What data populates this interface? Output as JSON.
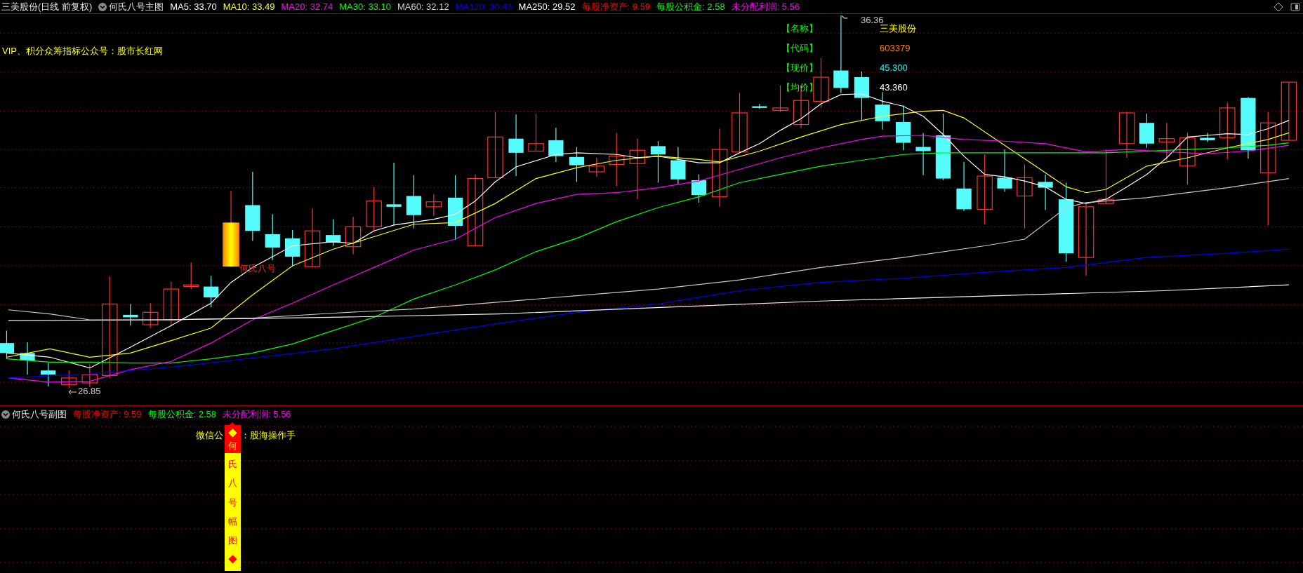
{
  "main_header": {
    "stock": "三美股份(日线 前复权)",
    "indicator": "何氏八号主图",
    "ma": [
      {
        "label": "MA5: 33.70",
        "color": "#ffffff"
      },
      {
        "label": "MA10: 33.49",
        "color": "#ffff00"
      },
      {
        "label": "MA20: 32.74",
        "color": "#ff00ff"
      },
      {
        "label": "MA30: 33.10",
        "color": "#00ff00"
      },
      {
        "label": "MA60: 32.12",
        "color": "#d0d0d0"
      },
      {
        "label": "MA120: 30.43",
        "color": "#0000ff"
      },
      {
        "label": "MA250: 29.52",
        "color": "#ffffff"
      }
    ],
    "finance": [
      {
        "label": "每股净资产: 9.59",
        "color": "#ff0000"
      },
      {
        "label": "每股公积金: 2.58",
        "color": "#00ff00"
      },
      {
        "label": "未分配利润: 5.56",
        "color": "#ff00ff"
      }
    ]
  },
  "main_chart": {
    "note": "VIP、积分众筹指标公众号：股市长红网",
    "info": [
      {
        "label": "【名称】",
        "value": "三美股份",
        "color": "#ffff00"
      },
      {
        "label": "【代码】",
        "value": "603379",
        "color": "#ff8000"
      },
      {
        "label": "【现价】",
        "value": "45.300",
        "color": "#00ffff"
      },
      {
        "label": "【均价】",
        "value": "43.360",
        "color": "#ffffff"
      }
    ],
    "high_label": "36.36",
    "low_label": "26.85",
    "signal_label": "何氏八号"
  },
  "sub_header": {
    "indicator": "何氏八号副图",
    "finance": [
      {
        "label": "每股净资产: 9.59",
        "color": "#ff0000"
      },
      {
        "label": "每股公积金: 2.58",
        "color": "#00ff00"
      },
      {
        "label": "未分配利润: 5.56",
        "color": "#ff00ff"
      }
    ]
  },
  "sub_chart": {
    "text_left": "微信公",
    "text_right": "：股海操作手",
    "bar_top": "◆何",
    "bar_bottom": "氏八号幅图◆"
  }
}
